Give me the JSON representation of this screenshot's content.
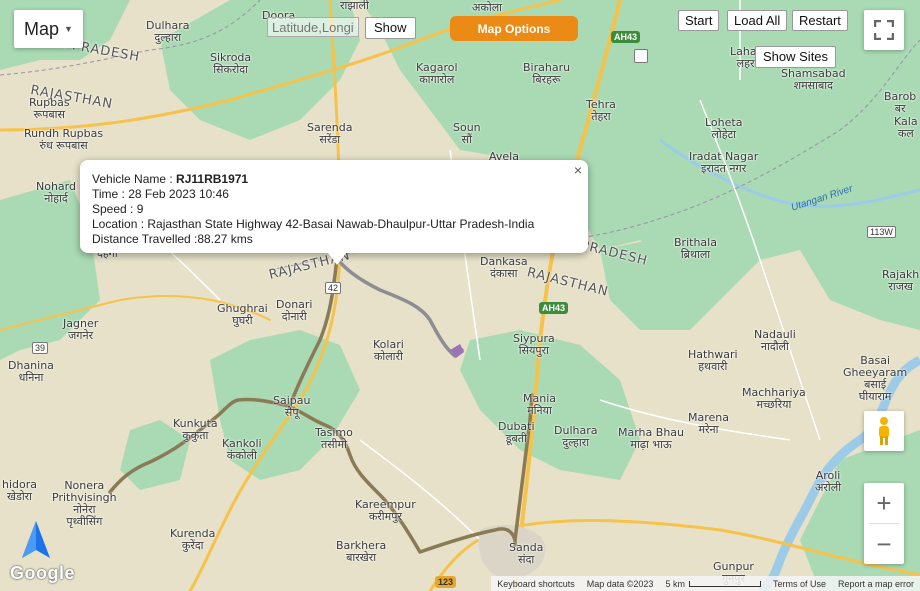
{
  "toolbar": {
    "map_type_label": "Map",
    "latlng_placeholder": "Latitude,Longitude",
    "show_label": "Show",
    "map_options_label": "Map Options",
    "start_label": "Start",
    "load_all_label": "Load All",
    "restart_label": "Restart",
    "show_sites_label": "Show Sites"
  },
  "info_window": {
    "vehicle_name_label": "Vehicle Name : ",
    "vehicle_name": "RJ11RB1971",
    "time": "Time : 28 Feb 2023 10:46",
    "speed": "Speed : 9",
    "location": "Location : Rajasthan State Highway 42-Basai Nawab-Dhaulpur-Uttar Pradesh-India",
    "distance": "Distance Travelled :88.27 kms",
    "close_glyph": "×"
  },
  "zoom": {
    "in_glyph": "+",
    "out_glyph": "−"
  },
  "colors": {
    "accent": "#ec8a16",
    "route": "#8a7a55",
    "route_recent": "#8d8d92",
    "forest": "#a6d9b0",
    "land": "#e6e1c8",
    "road": "#f6c24a",
    "water": "#9ccbe8"
  },
  "map": {
    "regions": {
      "up_top": "AR PRADESH",
      "rajasthan_left": "RAJASTHAN",
      "rajasthan_mid": "RAJASTHAN",
      "up_mid": "PRADESH",
      "rajasthan_right": "RAJASTHAN"
    },
    "places": {
      "doora": "Doora",
      "dulhara_top_en": "Dulhara",
      "dulhara_top_hi": "दुल्हारा",
      "sikroda_en": "Sikroda",
      "sikroda_hi": "सिकरोदा",
      "rajhali": "राझाली",
      "akola": "अकोला",
      "kagarol_en": "Kagarol",
      "kagarol_hi": "कागारोल",
      "biraharu_en": "Biraharu",
      "biraharu_hi": "बिरहरू",
      "tehra_en": "Tehra",
      "tehra_hi": "तेहरा",
      "lahar_en": "Lahar",
      "lahar_hi": "लहर",
      "shamsabad_en": "Shamsabad",
      "shamsabad_hi": "शमसाबाद",
      "rupbas_en": "Rupbas",
      "rupbas_hi": "रूपबास",
      "rundh_en": "Rundh Rupbas",
      "rundh_hi": "रुंध रूपबास",
      "sarenda_en": "Sarenda",
      "sarenda_hi": "सरेंडा",
      "soun_en": "Soun",
      "soun_hi": "सौं",
      "avela": "Avela",
      "loheta_en": "Loheta",
      "loheta_hi": "लोहेटा",
      "iradat_en": "Iradat Nagar",
      "iradat_hi": "इरादत नगर",
      "barobi_en": "Barob",
      "barobi_hi": "बर",
      "kalaj": "Kala",
      "kalaj_hi": "कल",
      "nohard_en": "Nohard",
      "nohard_hi": "नोहार्द",
      "brithala_en": "Brithala",
      "brithala_hi": "ब्रिथाला",
      "dankasa_en": "Dankasa",
      "dankasa_hi": "दंकासा",
      "dehgha": "देहगा",
      "ghughrai_en": "Ghughrai",
      "ghughrai_hi": "घुघरी",
      "donari_en": "Donari",
      "donari_hi": "दोनारी",
      "jagner_en": "Jagner",
      "jagner_hi": "जगनेर",
      "kolari_en": "Kolari",
      "kolari_hi": "कोलारी",
      "siypura_en": "Siypura",
      "siypura_hi": "सियपुरा",
      "nadauli_en": "Nadauli",
      "nadauli_hi": "नादौली",
      "rajakhe_en": "Rajakh",
      "rajakhe_hi": "राजख",
      "dhanina_en": "Dhanina",
      "dhanina_hi": "धनिना",
      "hathwari_en": "Hathwari",
      "hathwari_hi": "हथवारी",
      "basai_en": "Basai",
      "basai_hi": "Gheeyaram",
      "basai_hi2": "बसाई",
      "basai_hi3": "घीयाराम",
      "saipau_en": "Saipau",
      "saipau_hi": "सैपू",
      "mania_en": "Mania",
      "mania_hi": "मनिया",
      "machhariya_en": "Machhariya",
      "machhariya_hi": "मच्छरिया",
      "kunkuta_en": "Kunkuta",
      "kunkuta_hi": "कुकुता",
      "tasimo_en": "Tasimo",
      "tasimo_hi": "तसीमो",
      "dubati_en": "Dubati",
      "dubati_hi": "डूबती",
      "dulhara_en": "Dulhara",
      "dulhara_hi": "दुल्हारा",
      "marhabhau_en": "Marha Bhau",
      "marhabhau_hi": "माढ़ा भाऊ",
      "marena_en": "Marena",
      "marena_hi": "मरेना",
      "kankoli_en": "Kankoli",
      "kankoli_hi": "कंकोली",
      "nonera_en": "Nonera",
      "nonera_hi": "Prithvisingh",
      "nonera_hi2": "नोनेरा",
      "nonera_hi3": "पृथ्वीसिंग",
      "khidora_en": "hidora",
      "khidora_hi": "खेडोरा",
      "aroli_en": "Aroli",
      "aroli_hi": "अरोली",
      "kareempur_en": "Kareempur",
      "kareempur_hi": "करीमपुर",
      "kurenda_en": "Kurenda",
      "kurenda_hi": "कुरेंदा",
      "barkhera_en": "Barkhera",
      "barkhera_hi": "बारखेरा",
      "sanda_en": "Sanda",
      "sanda_hi": "संदा",
      "gunpur_en": "Gunpur",
      "gunpur_hi": "गुनपुर"
    },
    "river": "Utangan River",
    "shields": {
      "ah43_top": "AH43",
      "ah43_mid": "AH43",
      "nh113": "113W",
      "nh39": "39",
      "sh42": "42",
      "nh123": "123"
    }
  },
  "footer": {
    "keyboard": "Keyboard shortcuts",
    "map_data": "Map data ©2023",
    "scale": "5 km",
    "terms": "Terms of Use",
    "report": "Report a map error"
  },
  "logo": "Google"
}
